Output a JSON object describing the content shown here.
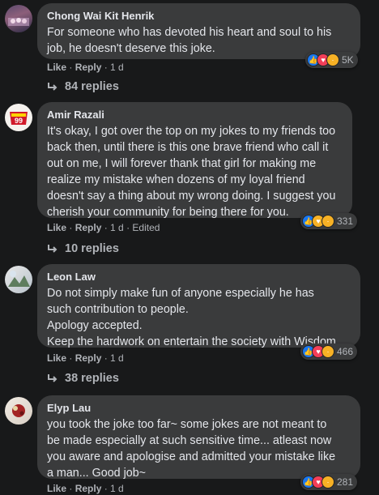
{
  "colors": {
    "background": "#18191a",
    "bubble": "#3a3b3c",
    "text": "#e4e6eb",
    "muted": "#b0b3b8",
    "like": "#1877f2",
    "love": "#f33e58",
    "yellow": "#f7b125"
  },
  "comments": [
    {
      "name": "Chong Wai Kit Henrik",
      "lines": [
        "For someone who has devoted his heart and soul to his",
        "job, he doesn't deserve this joke."
      ],
      "like": "Like",
      "reply": "Reply",
      "time": "1 d",
      "edited": "",
      "reaction_icons": [
        "like-icon",
        "love-icon",
        "sad-icon"
      ],
      "reaction_count": "5K",
      "replies": "84 replies"
    },
    {
      "name": "Amir Razali",
      "avatar_badge": "99",
      "lines": [
        "It's okay, I got over the top on my jokes to my friends too",
        "back then, until there is this one brave friend who call it",
        "out on me, I will forever thank that girl for making me",
        "realize my mistake when dozens of my loyal friend",
        "doesn't say a thing about my wrong doing. I suggest you",
        "cherish your community for being there for you."
      ],
      "like": "Like",
      "reply": "Reply",
      "time": "1 d",
      "edited": "Edited",
      "reaction_icons": [
        "like-icon",
        "care-icon",
        "haha-icon"
      ],
      "reaction_count": "331",
      "replies": "10 replies"
    },
    {
      "name": "Leon Law",
      "lines": [
        "Do not simply make fun of anyone especially he has",
        "such contribution to people.",
        "Apology accepted.",
        "Keep the hardwork on entertain the society with Wisdom."
      ],
      "like": "Like",
      "reply": "Reply",
      "time": "1 d",
      "edited": "",
      "reaction_icons": [
        "like-icon",
        "love-icon",
        "haha-icon"
      ],
      "reaction_count": "466",
      "replies": "38 replies"
    },
    {
      "name": "Elyp Lau",
      "lines": [
        "you took the joke too far~ some jokes are not meant to",
        "be made especially at such sensitive time... atleast now",
        "you aware and apologise and admitted your mistake like",
        "a man... Good job~"
      ],
      "like": "Like",
      "reply": "Reply",
      "time": "1 d",
      "edited": "",
      "reaction_icons": [
        "like-icon",
        "love-icon",
        "haha-icon"
      ],
      "reaction_count": "281",
      "replies": ""
    }
  ]
}
